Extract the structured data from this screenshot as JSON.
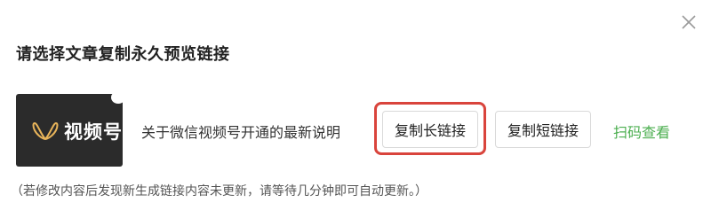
{
  "dialog": {
    "title": "请选择文章复制永久预览链接",
    "close_icon": "close-icon"
  },
  "article": {
    "cover": {
      "logo_icon": "video-channel-logo-icon",
      "logo_text": "视频号",
      "background": "#2b2b2b"
    },
    "title": "关于微信视频号开通的最新说明",
    "buttons": {
      "copy_long": "复制长链接",
      "copy_short": "复制短链接"
    },
    "scan_link": "扫码查看"
  },
  "note": "（若修改内容后发现新生成链接内容未更新，请等待几分钟即可自动更新。）",
  "colors": {
    "highlight_border": "#d9443c",
    "scan_link": "#4caf50"
  }
}
